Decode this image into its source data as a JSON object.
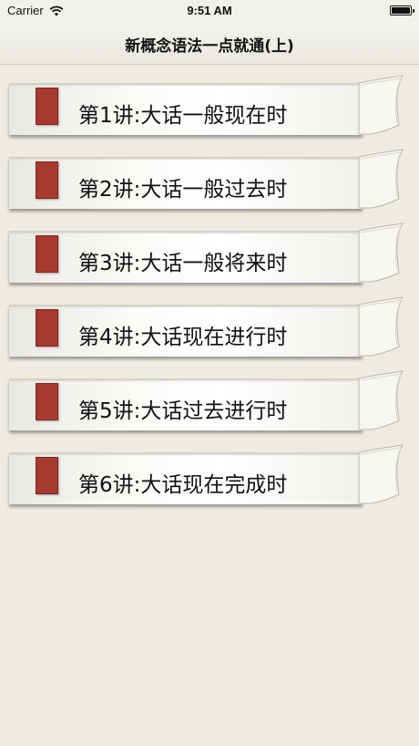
{
  "status_bar": {
    "carrier": "Carrier",
    "time": "9:51 AM",
    "wifi_icon": "wifi-icon",
    "battery_icon": "battery-icon"
  },
  "nav": {
    "title": "新概念语法一点就通(上)"
  },
  "lessons": [
    {
      "label": "第1讲:大话一般现在时"
    },
    {
      "label": "第2讲:大话一般过去时"
    },
    {
      "label": "第3讲:大话一般将来时"
    },
    {
      "label": "第4讲:大话现在进行时"
    },
    {
      "label": "第5讲:大话过去进行时"
    },
    {
      "label": "第6讲:大话现在完成时"
    }
  ],
  "colors": {
    "background": "#eeebe0",
    "marker": "#a8392f",
    "card": "#fbfbf8"
  }
}
